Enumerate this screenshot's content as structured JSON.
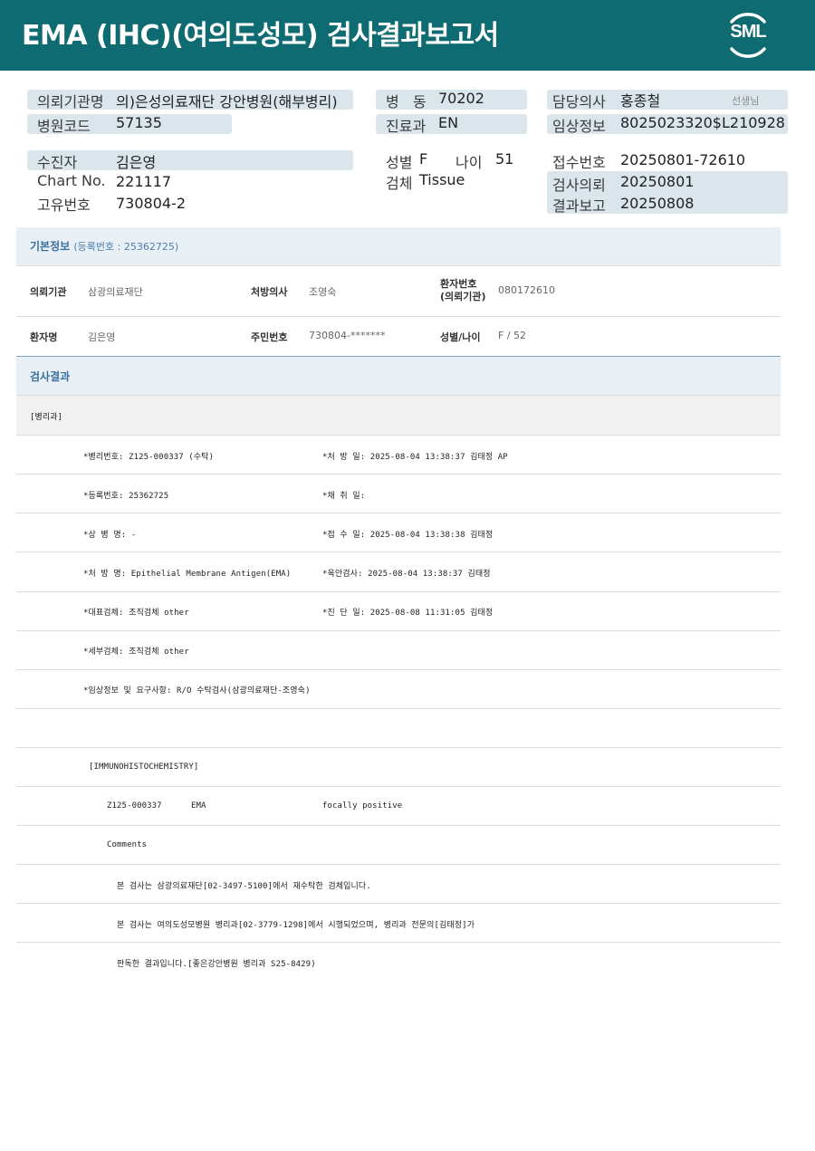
{
  "header": {
    "title": "EMA  (IHC)(여의도성모) 검사결과보고서",
    "logo": "SML",
    "colors": {
      "banner": "#0f6b72",
      "field_bg": "#dbe6ec",
      "section_title": "#3b6fa0"
    }
  },
  "info": {
    "institution": {
      "label": "의뢰기관명",
      "value": "의)은성의료재단 강안병원(해부병리)"
    },
    "hospital_code": {
      "label": "병원코드",
      "value": "57135"
    },
    "ward": {
      "label": "병   동",
      "value": "70202"
    },
    "department": {
      "label": "진료과",
      "value": "EN"
    },
    "doctor": {
      "label": "담당의사",
      "value": "홍종철",
      "suffix": "선생님"
    },
    "clinical_info": {
      "label": "임상정보",
      "value": "8025023320$L210928"
    },
    "patient": {
      "label": "수진자",
      "value": "김은영"
    },
    "chart_no": {
      "label": "Chart No.",
      "value": "221117"
    },
    "unique_no": {
      "label": "고유번호",
      "value": "730804-2"
    },
    "sex": {
      "label": "성별",
      "value": "F"
    },
    "age": {
      "label": "나이",
      "value": "51"
    },
    "specimen": {
      "label": "검체",
      "value": "Tissue"
    },
    "receipt_no": {
      "label": "접수번호",
      "value": "20250801-72610"
    },
    "request_date": {
      "label": "검사의뢰",
      "value": "20250801"
    },
    "report_date": {
      "label": "결과보고",
      "value": "20250808"
    }
  },
  "basic": {
    "title": "기본정보",
    "reg_note": "(등록번호 : 25362725)",
    "rows": [
      [
        {
          "label": "의뢰기관",
          "value": "삼광의료재단"
        },
        {
          "label": "처방의사",
          "value": "조영숙"
        },
        {
          "label_line1": "환자번호",
          "label_line2": "(의뢰기관)",
          "value": "080172610"
        }
      ],
      [
        {
          "label": "환자명",
          "value": "김은영"
        },
        {
          "label": "주민번호",
          "value": "730804-*******"
        },
        {
          "label": "성별/나이",
          "value": "F / 52"
        }
      ]
    ]
  },
  "result": {
    "title": "검사결과",
    "dept": "[병리과]",
    "lines": [
      {
        "left": "*병리번호: Z125-000337 (수탁)",
        "right": "*처 방 일: 2025-08-04 13:38:37  김태정 AP"
      },
      {
        "left": "*등록번호: 25362725",
        "right": "*채 취 일:"
      },
      {
        "left": "*상 병 명: -",
        "right": "*접 수 일: 2025-08-04 13:38:38  김태정"
      },
      {
        "left": "*처 방 명: Epithelial Membrane Antigen(EMA)",
        "right": "*육안검사: 2025-08-04 13:38:37  김태정"
      },
      {
        "left": "*대표검체: 조직검체 other",
        "right": "*진 단 일: 2025-08-08 11:31:05  김태정"
      },
      {
        "left": "*세부검체: 조직검체 other",
        "right": ""
      },
      {
        "left": "*임상정보 및 요구사항: R/O 수탁검사(삼광의료재단-조영숙)",
        "right": ""
      }
    ],
    "ihc_header": "[IMMUNOHISTOCHEMISTRY]",
    "ihc_row": {
      "id": "Z125-000337",
      "marker": "EMA",
      "result": "focally positive"
    },
    "comments_label": "Comments",
    "comment_lines": [
      "본 검사는 삼광의료재단[02-3497-5100]에서 재수탁한 검체입니다.",
      "본 검사는 여의도성모병원 병리과[02-3779-1298]에서 시행되었으며, 병리과 전문의[김태정]가",
      "판독한 결과입니다.[좋은강안병원 병리과 S25-8429)"
    ]
  }
}
